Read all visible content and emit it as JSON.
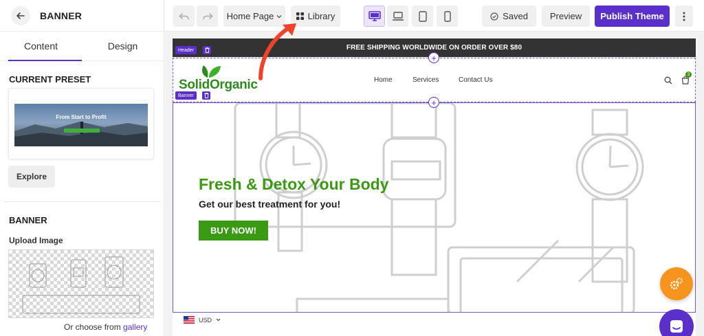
{
  "sidebar": {
    "title": "BANNER",
    "tabs": [
      {
        "label": "Content",
        "active": true
      },
      {
        "label": "Design",
        "active": false
      }
    ],
    "current_preset": {
      "title": "CURRENT PRESET",
      "preview_heading": "From Start to Profit",
      "explore_label": "Explore"
    },
    "banner_section": {
      "title": "BANNER",
      "upload_label": "Upload Image",
      "choose_text": "Or choose from",
      "gallery_link": "gallery"
    }
  },
  "toolbar": {
    "page_select": "Home Page",
    "library_label": "Library",
    "devices": [
      "desktop",
      "laptop",
      "tablet",
      "mobile"
    ],
    "active_device": "desktop",
    "saved_label": "Saved",
    "preview_label": "Preview",
    "publish_label": "Publish Theme"
  },
  "preview": {
    "announcement": "FREE SHIPPING WORLDWIDE ON ORDER OVER $80",
    "header_tag": "Header",
    "banner_tag": "Banner",
    "logo_text": "SolidOrganic",
    "nav": [
      "Home",
      "Services",
      "Contact Us"
    ],
    "cart_count": "3",
    "banner_heading": "Fresh & Detox Your Body",
    "banner_subheading": "Get our best treatment for you!",
    "banner_button": "BUY NOW!",
    "currency": "USD"
  },
  "colors": {
    "accent": "#5b2fc9",
    "green": "#3a9a14",
    "orange_fab": "#f7941d",
    "arrow": "#f0442a"
  }
}
